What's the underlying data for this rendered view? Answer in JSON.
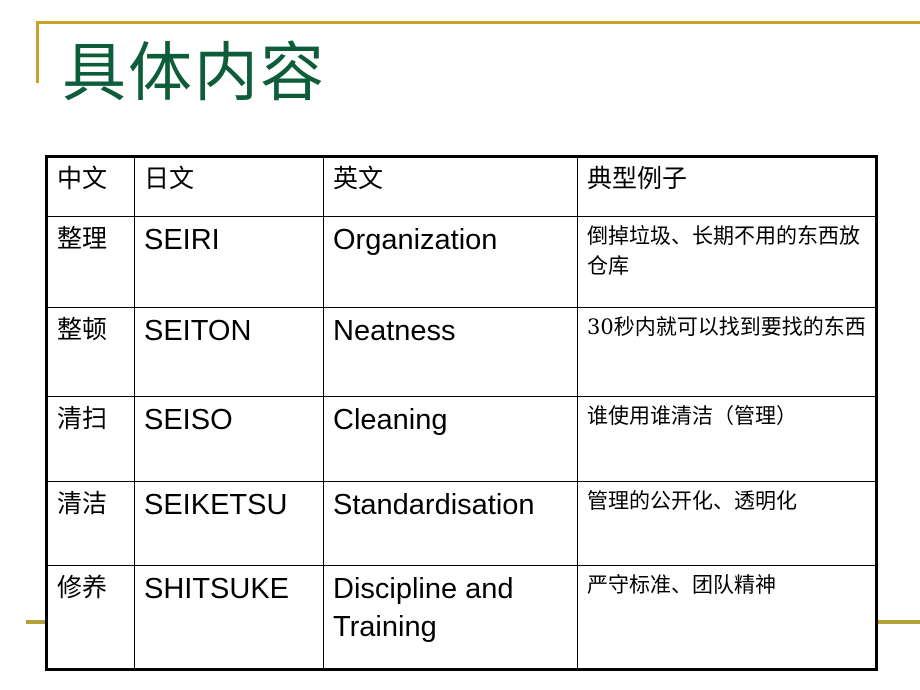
{
  "slide": {
    "title": "具体内容",
    "title_color": "#0d5c3a",
    "accent_line_color": "#c9a227",
    "bottom_line_color": "#b5a13a",
    "background_color": "#ffffff"
  },
  "table": {
    "headers": [
      "中文",
      "日文",
      "英文",
      "典型例子"
    ],
    "rows": [
      {
        "chinese": "整理",
        "japanese": "SEIRI",
        "english": "Organization",
        "example": "倒掉垃圾、长期不用的东西放仓库"
      },
      {
        "chinese": "整顿",
        "japanese": "SEITON",
        "english": "Neatness",
        "example": "30秒内就可以找到要找的东西"
      },
      {
        "chinese": "清扫",
        "japanese": "SEISO",
        "english": "Cleaning",
        "example": "谁使用谁清洁（管理）"
      },
      {
        "chinese": "清洁",
        "japanese": "SEIKETSU",
        "english": "Standardisation",
        "example": "管理的公开化、透明化"
      },
      {
        "chinese": "修养",
        "japanese": "SHITSUKE",
        "english": "Discipline and Training",
        "example": "严守标准、团队精神"
      }
    ]
  }
}
